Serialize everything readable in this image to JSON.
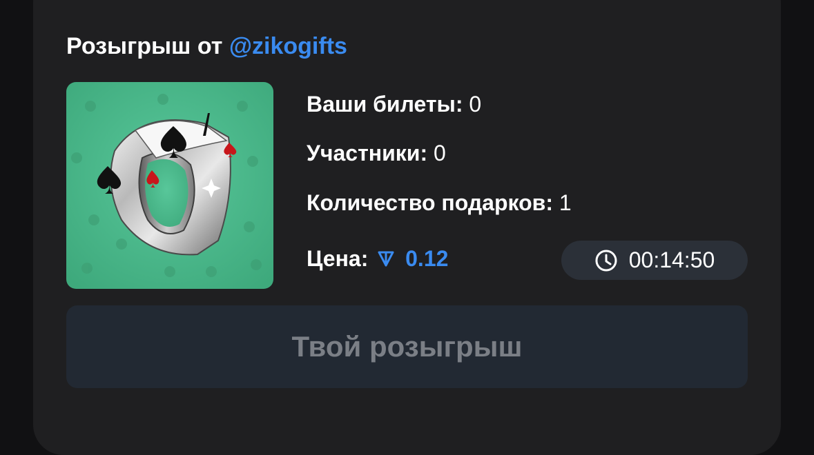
{
  "giveaway": {
    "title_prefix": "Розыгрыш от",
    "username": "@zikogifts"
  },
  "prize": {
    "image_icon": "ring-with-spade-icon",
    "image_bg_color": "#4ab68c"
  },
  "stats": {
    "tickets_label": "Ваши билеты:",
    "tickets_value": "0",
    "participants_label": "Участники:",
    "participants_value": "0",
    "gifts_label": "Количество подарков:",
    "gifts_value": "1",
    "price_label": "Цена:",
    "price_value": "0.12",
    "price_currency_icon": "ton-icon"
  },
  "timer": {
    "icon": "clock-icon",
    "value": "00:14:50"
  },
  "action": {
    "label": "Твой розыгрыш"
  },
  "colors": {
    "accent": "#3a8bf0",
    "card_bg": "#1f1f21",
    "button_bg": "#222933",
    "button_text": "#7b7f86"
  }
}
